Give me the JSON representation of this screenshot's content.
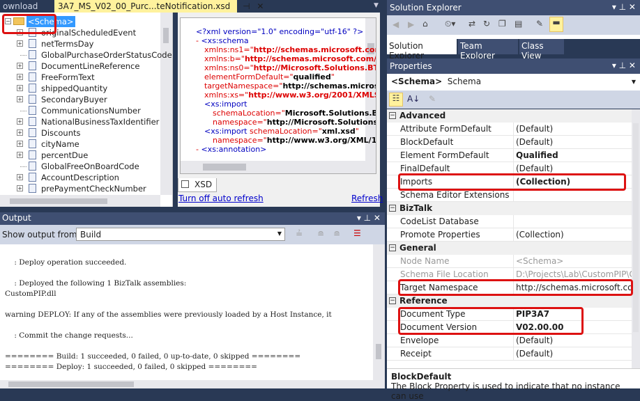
{
  "doc_tabs": {
    "prev": "ownload",
    "active": "3A7_MS_V02_00_Purc...teNotification.xsd",
    "pin": "⊣",
    "close": "✕"
  },
  "tree": {
    "root": "<Schema>",
    "nodes": [
      {
        "label": "originalScheduledEvent",
        "type": "record",
        "expandable": true
      },
      {
        "label": "netTermsDay",
        "type": "record",
        "expandable": true
      },
      {
        "label": "GlobalPurchaseOrderStatusCode",
        "type": "field",
        "expandable": false
      },
      {
        "label": "DocumentLineReference",
        "type": "record",
        "expandable": true
      },
      {
        "label": "FreeFormText",
        "type": "record",
        "expandable": true
      },
      {
        "label": "shippedQuantity",
        "type": "record",
        "expandable": true
      },
      {
        "label": "SecondaryBuyer",
        "type": "record",
        "expandable": true
      },
      {
        "label": "CommunicationsNumber",
        "type": "field",
        "expandable": false
      },
      {
        "label": "NationalBusinessTaxIdentifier",
        "type": "record",
        "expandable": true
      },
      {
        "label": "Discounts",
        "type": "record",
        "expandable": true
      },
      {
        "label": "cityName",
        "type": "record",
        "expandable": true
      },
      {
        "label": "percentDue",
        "type": "record",
        "expandable": true
      },
      {
        "label": "GlobalFreeOnBoardCode",
        "type": "field",
        "expandable": false
      },
      {
        "label": "AccountDescription",
        "type": "record",
        "expandable": true
      },
      {
        "label": "prePaymentCheckNumber",
        "type": "record",
        "expandable": true
      }
    ]
  },
  "xml": {
    "lines": [
      {
        "parts": [
          {
            "t": "<?xml version=\"1.0\" encoding=\"utf-16\" ?>",
            "c": "blue"
          }
        ],
        "indent": 0
      },
      {
        "parts": [
          {
            "t": "- ",
            "c": "red"
          },
          {
            "t": "<xs:schema",
            "c": "blue"
          }
        ],
        "indent": -1
      },
      {
        "parts": [
          {
            "t": "xmlns:ns1=\"",
            "c": "red"
          },
          {
            "t": "http://schemas.microsoft.com/l",
            "c": "redb"
          }
        ],
        "indent": 1
      },
      {
        "parts": [
          {
            "t": "xmlns:b=\"",
            "c": "red"
          },
          {
            "t": "http://schemas.microsoft.com/Bi",
            "c": "redb"
          }
        ],
        "indent": 1
      },
      {
        "parts": [
          {
            "t": "xmlns:ns0=\"",
            "c": "red"
          },
          {
            "t": "http://Microsoft.Solutions.BTAI",
            "c": "redb"
          }
        ],
        "indent": 1
      },
      {
        "parts": [
          {
            "t": "elementFormDefault=\"",
            "c": "red"
          },
          {
            "t": "qualified",
            "c": "blk"
          },
          {
            "t": "\"",
            "c": "red"
          }
        ],
        "indent": 1
      },
      {
        "parts": [
          {
            "t": "targetNamespace=\"",
            "c": "red"
          },
          {
            "t": "http://schemas.microsoft",
            "c": "blk"
          }
        ],
        "indent": 1
      },
      {
        "parts": [
          {
            "t": "xmlns:xs=\"",
            "c": "red"
          },
          {
            "t": "http://www.w3.org/2001/XMLSc",
            "c": "redb"
          }
        ],
        "indent": 1
      },
      {
        "parts": [
          {
            "t": "<xs:import",
            "c": "blue"
          }
        ],
        "indent": 1
      },
      {
        "parts": [
          {
            "t": "schemaLocation=\"",
            "c": "red"
          },
          {
            "t": "Microsoft.Solutions.BTA",
            "c": "blk"
          }
        ],
        "indent": 2
      },
      {
        "parts": [
          {
            "t": "namespace=\"",
            "c": "red"
          },
          {
            "t": "http://Microsoft.Solutions.B",
            "c": "blk"
          }
        ],
        "indent": 2
      },
      {
        "parts": [
          {
            "t": "<xs:import ",
            "c": "blue"
          },
          {
            "t": "schemaLocation=\"",
            "c": "red"
          },
          {
            "t": "xml.xsd",
            "c": "blk"
          },
          {
            "t": "\"",
            "c": "red"
          }
        ],
        "indent": 1
      },
      {
        "parts": [
          {
            "t": "namespace=\"",
            "c": "red"
          },
          {
            "t": "http://www.w3.org/XML/19",
            "c": "blk"
          }
        ],
        "indent": 2
      },
      {
        "parts": [
          {
            "t": "- ",
            "c": "red"
          },
          {
            "t": "<xs:annotation>",
            "c": "blue"
          }
        ],
        "indent": 0
      }
    ]
  },
  "xsd_tab": "XSD",
  "links": {
    "auto_refresh": "Turn off auto refresh",
    "refresh": "Refresh"
  },
  "output": {
    "title": "Output",
    "show_from_label": "Show output from:",
    "source": "Build",
    "lines": [
      "    : Deploy operation succeeded.",
      "",
      "    : Deployed the following 1 BizTalk assemblies:",
      "CustomPIP.dll",
      "",
      "warning DEPLOY: If any of the assemblies were previously loaded by a Host Instance, it",
      "",
      "    : Commit the change requests...",
      "",
      "======== Build: 1 succeeded, 0 failed, 0 up-to-date, 0 skipped ========",
      "======== Deploy: 1 succeeded, 0 failed, 0 skipped ========"
    ]
  },
  "solution_explorer": {
    "title": "Solution Explorer",
    "tabs": [
      "Solution Explorer",
      "Team Explorer",
      "Class View"
    ]
  },
  "properties": {
    "title": "Properties",
    "object_name": "<Schema>",
    "object_type": "Schema",
    "categories": [
      {
        "name": "Advanced",
        "rows": [
          {
            "name": "Attribute FormDefault",
            "value": "(Default)"
          },
          {
            "name": "BlockDefault",
            "value": "(Default)"
          },
          {
            "name": "Element FormDefault",
            "value": "Qualified",
            "bold": true
          },
          {
            "name": "FinalDefault",
            "value": "(Default)"
          },
          {
            "name": "Imports",
            "value": "(Collection)",
            "bold": true
          },
          {
            "name": "Schema Editor Extensions",
            "value": ""
          }
        ]
      },
      {
        "name": "BizTalk",
        "rows": [
          {
            "name": "CodeList Database",
            "value": ""
          },
          {
            "name": "Promote Properties",
            "value": "(Collection)"
          }
        ]
      },
      {
        "name": "General",
        "rows": [
          {
            "name": "Node Name",
            "value": "<Schema>",
            "disabled": true
          },
          {
            "name": "Schema File Location",
            "value": "D:\\Projects\\Lab\\CustomPIP\\Cu",
            "disabled": true
          },
          {
            "name": "Target Namespace",
            "value": "http://schemas.microsoft.com"
          }
        ]
      },
      {
        "name": "Reference",
        "rows": [
          {
            "name": "Document Type",
            "value": "PIP3A7",
            "bold": true
          },
          {
            "name": "Document Version",
            "value": "V02.00.00",
            "bold": true
          },
          {
            "name": "Envelope",
            "value": "(Default)"
          },
          {
            "name": "Receipt",
            "value": "(Default)"
          }
        ]
      }
    ],
    "description_title": "BlockDefault",
    "description_text": "The Block Property is used to indicate that no instance can use"
  },
  "colors": {
    "accent_tab": "#fff29d",
    "panel_header": "#3f4f72",
    "background": "#293955",
    "highlight": "#d11111",
    "selection": "#3399ff"
  }
}
